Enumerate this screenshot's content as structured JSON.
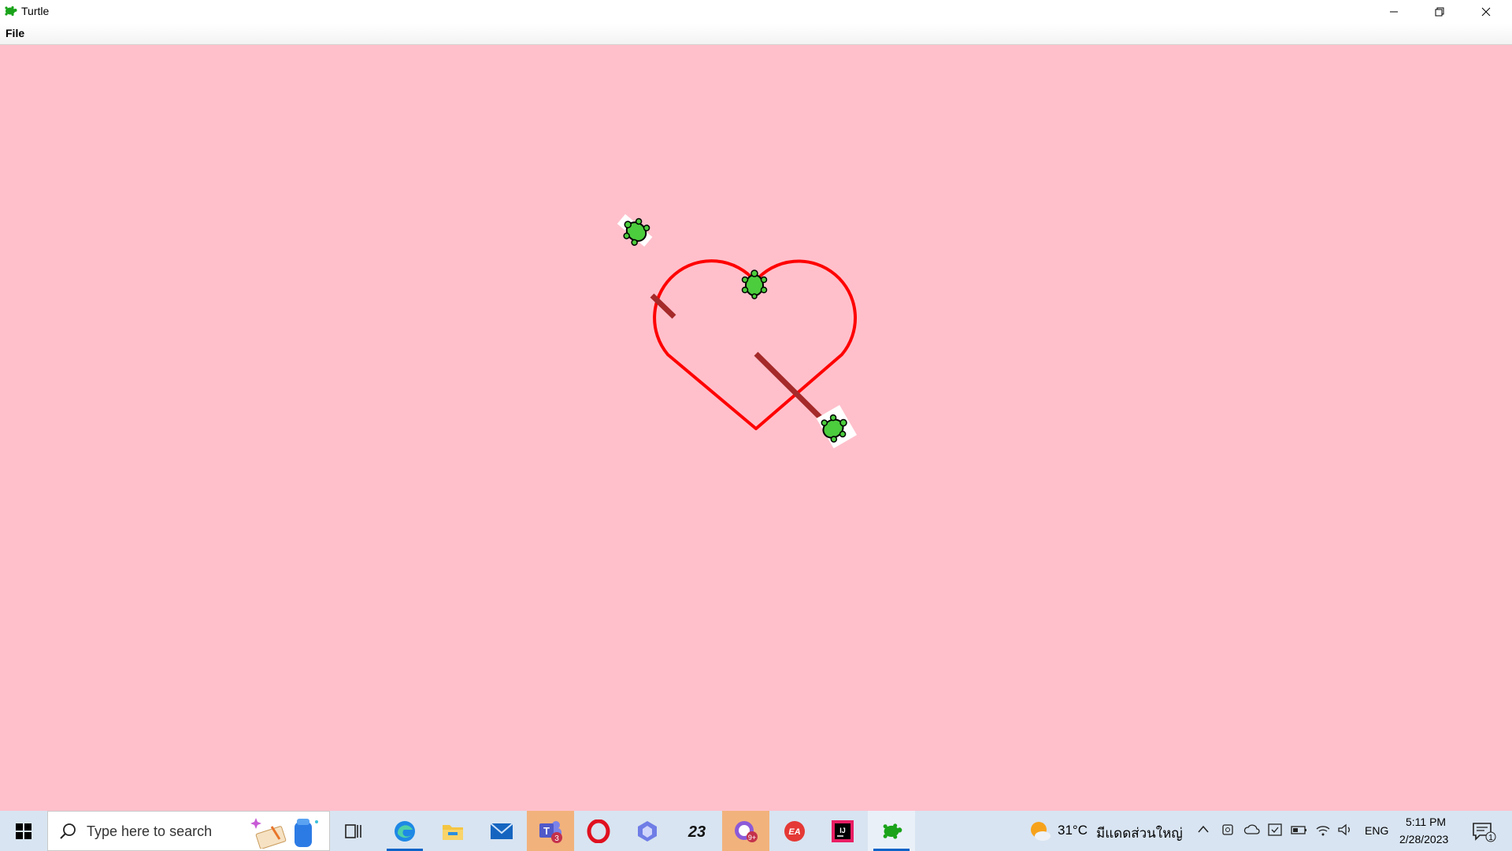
{
  "window": {
    "title": "Turtle",
    "menu": {
      "file_label": "File"
    }
  },
  "canvas": {
    "background": "#ffc0cb",
    "heart_color": "#ff0000",
    "arrow_color": "#a52a2a",
    "turtle_color": "#4ccd3d"
  },
  "taskbar": {
    "search_placeholder": "Type here to search",
    "apps": [
      {
        "name": "task-view"
      },
      {
        "name": "edge"
      },
      {
        "name": "file-explorer"
      },
      {
        "name": "mail"
      },
      {
        "name": "teams",
        "badge": "3"
      },
      {
        "name": "opera"
      },
      {
        "name": "copilot"
      },
      {
        "name": "app-23",
        "label": "23"
      },
      {
        "name": "messenger",
        "badge": "9+"
      },
      {
        "name": "ea",
        "label": "EA"
      },
      {
        "name": "intellij",
        "label": "IJ"
      },
      {
        "name": "turtle"
      }
    ],
    "weather": {
      "temp": "31°C",
      "desc": "มีแดดส่วนใหญ่"
    },
    "language": "ENG",
    "time": "5:11 PM",
    "date": "2/28/2023",
    "notification_count": "1"
  }
}
